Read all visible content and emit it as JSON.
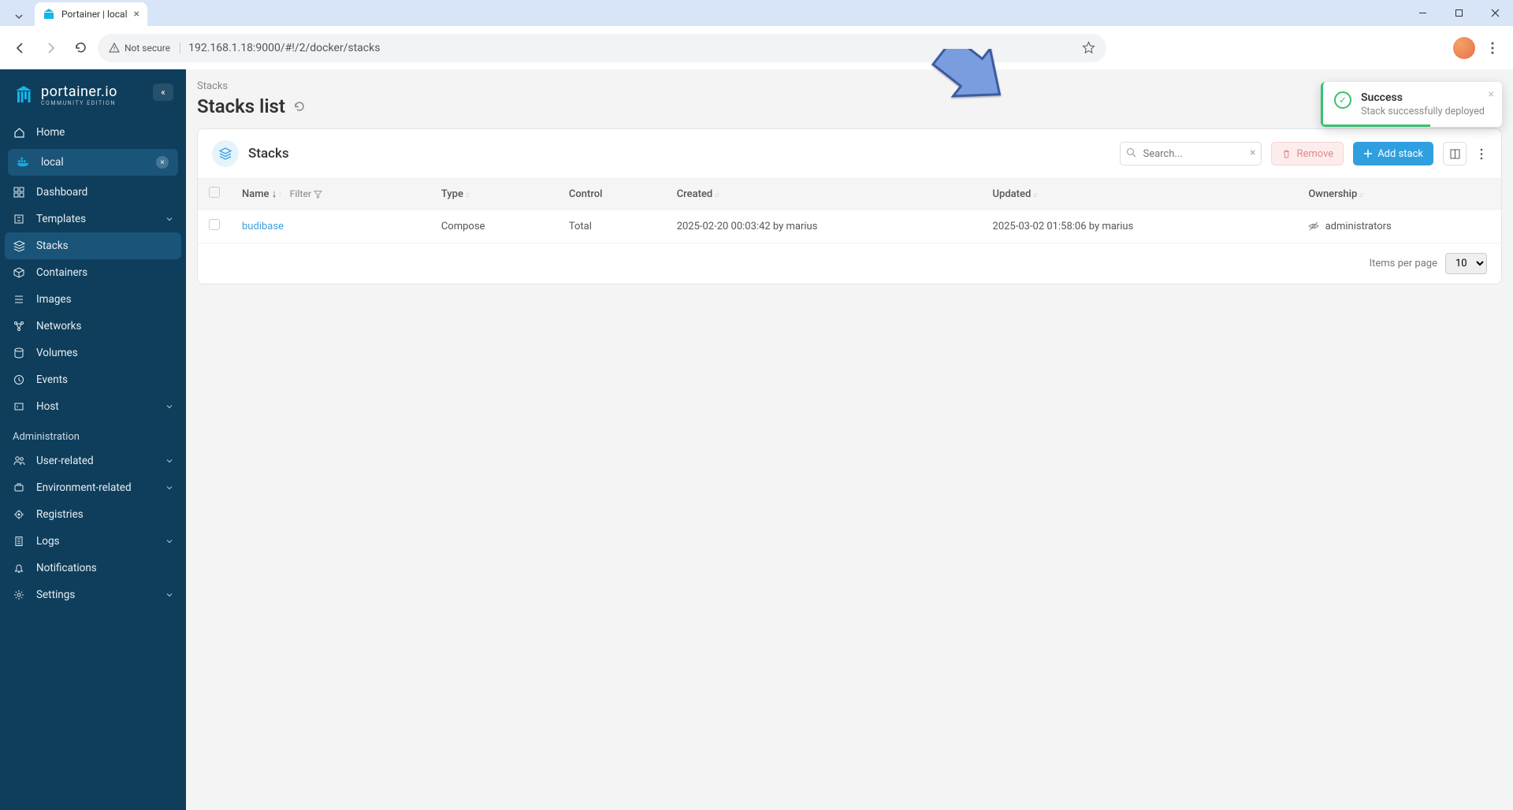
{
  "browser": {
    "tab_title": "Portainer | local",
    "security_label": "Not secure",
    "url": "192.168.1.18:9000/#!/2/docker/stacks"
  },
  "sidebar": {
    "brand": "portainer.io",
    "edition": "COMMUNITY EDITION",
    "home": "Home",
    "env_name": "local",
    "items": [
      "Dashboard",
      "Templates",
      "Stacks",
      "Containers",
      "Images",
      "Networks",
      "Volumes",
      "Events",
      "Host"
    ],
    "admin_title": "Administration",
    "admin_items": [
      "User-related",
      "Environment-related",
      "Registries",
      "Logs",
      "Notifications",
      "Settings"
    ]
  },
  "page": {
    "breadcrumb": "Stacks",
    "title": "Stacks list",
    "card_title": "Stacks",
    "search_placeholder": "Search...",
    "remove_label": "Remove",
    "add_label": "Add stack",
    "columns": {
      "name": "Name",
      "filter": "Filter",
      "type": "Type",
      "control": "Control",
      "created": "Created",
      "updated": "Updated",
      "ownership": "Ownership"
    },
    "rows": [
      {
        "name": "budibase",
        "type": "Compose",
        "control": "Total",
        "created": "2025-02-20 00:03:42 by marius",
        "updated": "2025-03-02 01:58:06 by marius",
        "ownership": "administrators"
      }
    ],
    "items_per_page_label": "Items per page",
    "items_per_page_value": "10"
  },
  "toast": {
    "title": "Success",
    "message": "Stack successfully deployed"
  }
}
